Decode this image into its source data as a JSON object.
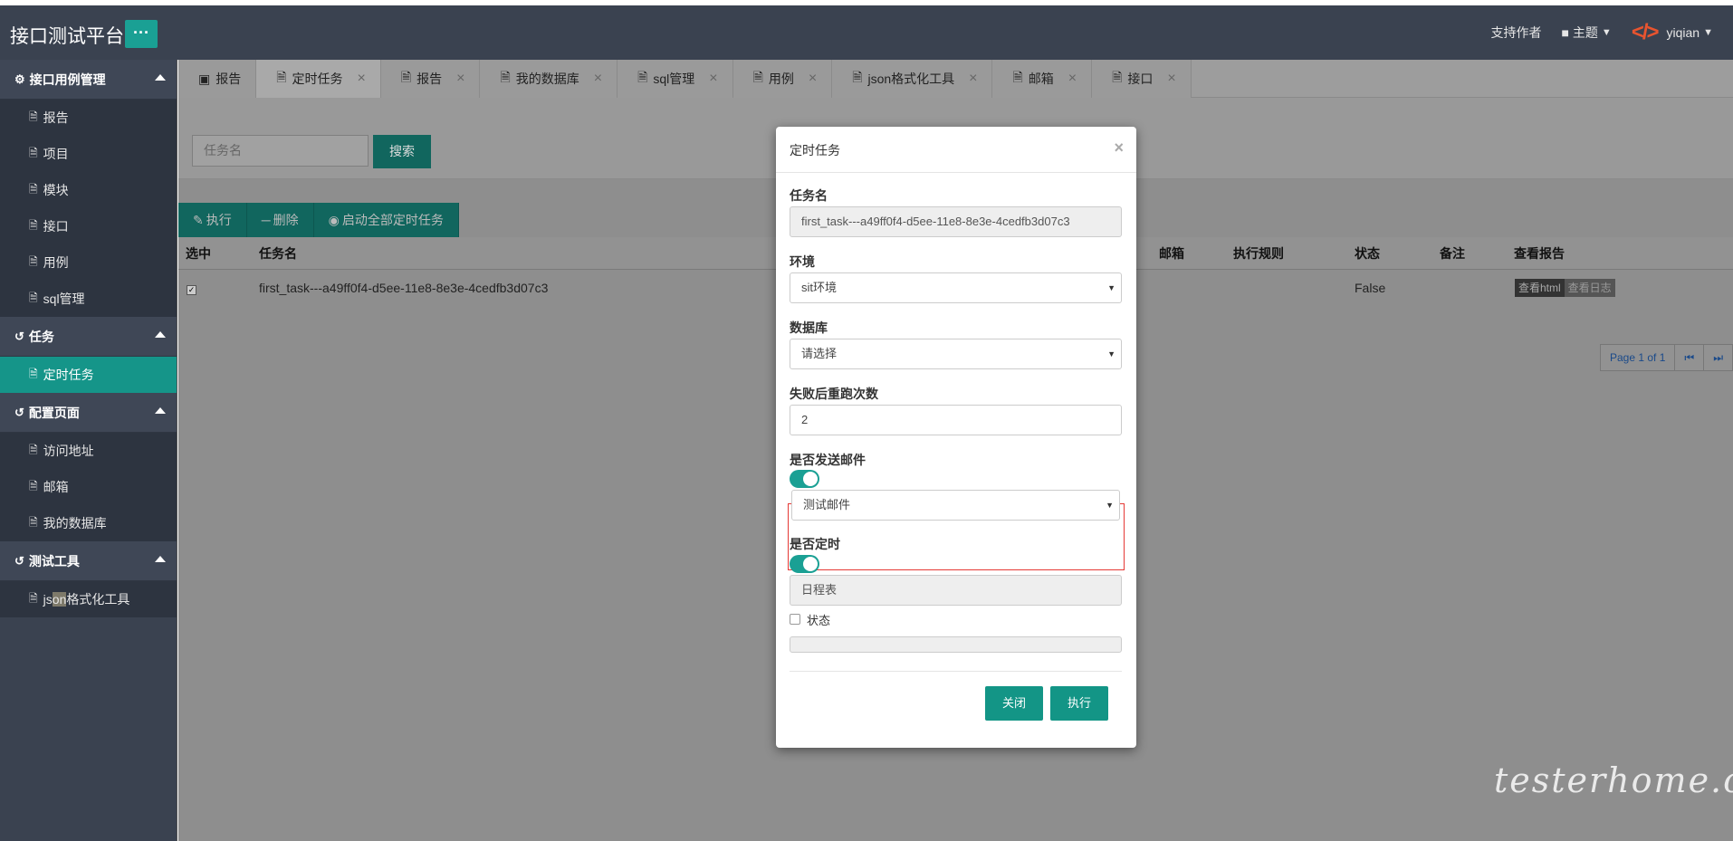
{
  "header": {
    "title": "接口测试平台",
    "menu_button": "···",
    "support": "支持作者",
    "theme": "主题",
    "user": "yiqian"
  },
  "sidebar": {
    "groups": [
      {
        "label": "接口用例管理",
        "items": [
          "报告",
          "项目",
          "模块",
          "接口",
          "用例",
          "sql管理"
        ]
      },
      {
        "label": "任务",
        "items": [
          "定时任务"
        ]
      },
      {
        "label": "配置页面",
        "items": [
          "访问地址",
          "邮箱",
          "我的数据库"
        ]
      },
      {
        "label": "测试工具",
        "items": [
          "js",
          "on",
          "格式化工具"
        ]
      }
    ]
  },
  "tabs": [
    "报告",
    "定时任务",
    "报告",
    "我的数据库",
    "sql管理",
    "用例",
    "json格式化工具",
    "邮箱",
    "接口"
  ],
  "search": {
    "placeholder": "任务名",
    "button": "搜索"
  },
  "toolbar": {
    "execute": "执行",
    "delete": "删除",
    "start_all": "启动全部定时任务"
  },
  "table": {
    "headers": [
      "选中",
      "任务名",
      "邮箱",
      "执行规则",
      "状态",
      "备注",
      "查看报告"
    ],
    "rows": [
      {
        "name": "first_task---a49ff0f4-d5ee-11e8-8e3e-4cedfb3d07c3",
        "status": "False",
        "view_html": "查看html",
        "view_log": "查看日志"
      }
    ]
  },
  "pager": {
    "text": "Page 1 of 1",
    "first": "⏮",
    "last": "⏭"
  },
  "modal": {
    "title": "定时任务",
    "close_x": "×",
    "task_name_label": "任务名",
    "task_name_value": "first_task---a49ff0f4-d5ee-11e8-8e3e-4cedfb3d07c3",
    "env_label": "环境",
    "env_value": "sit环境",
    "db_label": "数据库",
    "db_value": "请选择",
    "retry_label": "失败后重跑次数",
    "retry_value": "2",
    "send_mail_label": "是否发送邮件",
    "mail_value": "测试邮件",
    "scheduled_label": "是否定时",
    "schedule_placeholder": "日程表",
    "status_label": "状态",
    "close_button": "关闭",
    "run_button": "执行"
  },
  "watermark": "testerhome.com",
  "colors": {
    "accent": "#1aa094",
    "header_bg": "#3a4250",
    "highlight_box": "#e53935"
  }
}
